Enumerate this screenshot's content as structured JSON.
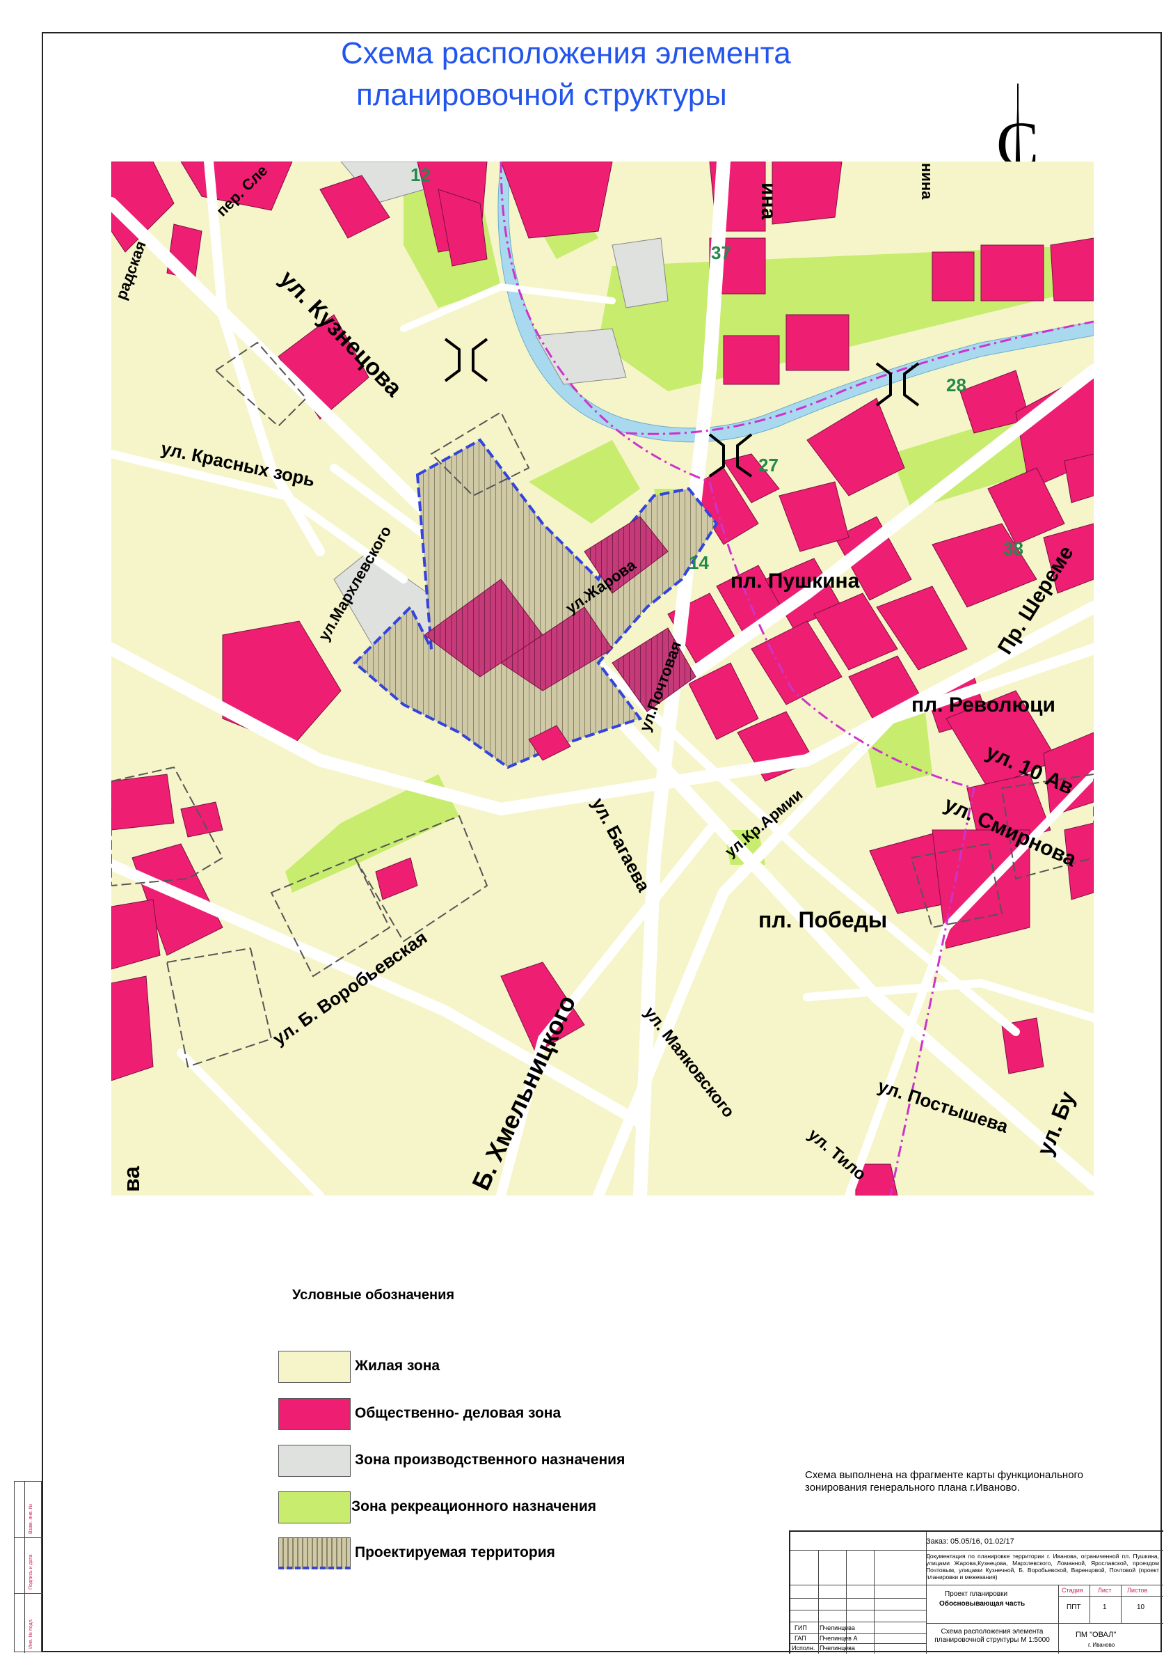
{
  "title": {
    "line1": "Схема расположения элемента",
    "line2": "планировочной структуры"
  },
  "compass": {
    "letter": "С"
  },
  "map": {
    "street_labels": [
      "ул. Кузнецова",
      "пер. Сле",
      "радская",
      "ул. Красных зорь",
      "ул.Мархлевского",
      "ул.Жарова",
      "пл. Пушкина",
      "ул.Почтовая",
      "пл. Революци",
      "Пр. Шереме",
      "ул. 10 Ав",
      "ул. Смирнова",
      "ул.Кр.Армии",
      "ул. Багаева",
      "пл. Победы",
      "ул. Б. Воробьевская",
      "ул. Маяковского",
      "ул. Постышева",
      "ул. Бу",
      "Б. Хмельницкого",
      "ул. Тило",
      "ина",
      "нина",
      "ва"
    ],
    "numbers": [
      "12",
      "37",
      "28",
      "27",
      "38",
      "14"
    ]
  },
  "legend": {
    "title": "Условные обозначения",
    "items": [
      {
        "label": "Жилая зона",
        "color": "#f6f5c9"
      },
      {
        "label": "Общественно- деловая зона",
        "color": "#ee1f73"
      },
      {
        "label": "Зона производственного назначения",
        "color": "#dfe1de"
      },
      {
        "label": "Зона рекреационного назначения",
        "color": "#c7ec6e"
      },
      {
        "label": "Проектируемая территория",
        "color": "#ffffff"
      }
    ]
  },
  "note": "Схема выполнена на фрагменте карты функционального зонирования генерального плана г.Иваново.",
  "stamp": {
    "order": "Заказ: 05.05/16,  01.02/17",
    "description": "Документация по планировке территории г. Иванова, ограниченной пл. Пушкина, улицами Жарова,Кузнецова, Мархлевского, Ломанной, Ярославской, проездом Почтовым, улицами Кузнечной, Б. Воробьевской, Варенцовой, Почтовой (проект планировки и межевания)",
    "project": "Проект планировки",
    "part": "Обосновывающая часть",
    "stage_h": "Стадия",
    "sheet_h": "Лист",
    "sheets_h": "Листов",
    "stage": "ППТ",
    "sheet": "1",
    "sheets": "10",
    "sheet_title": "Схема расположения элемента планировочной структуры  М 1:5000",
    "org": "ПМ \"ОВАЛ\"",
    "city": "г. Иваново",
    "rows": [
      {
        "role": "ГИП",
        "name": "Пчелинцева"
      },
      {
        "role": "ГАП",
        "name": "Пчелинцев А"
      },
      {
        "role": "Исполн.",
        "name": "Пчелинцева"
      }
    ]
  },
  "sidebar": [
    "Взам. инв. №",
    "Подпись и дата",
    "Инв. № подл."
  ],
  "colors": {
    "residential": "#f6f5c9",
    "business": "#ee1f73",
    "industrial": "#dfe1de",
    "recreation": "#c7ec6e",
    "river": "#a9d9ee",
    "road": "#ffffff",
    "boundary": "#3344dd",
    "route": "#cc33cc",
    "title": "#2255ee"
  }
}
